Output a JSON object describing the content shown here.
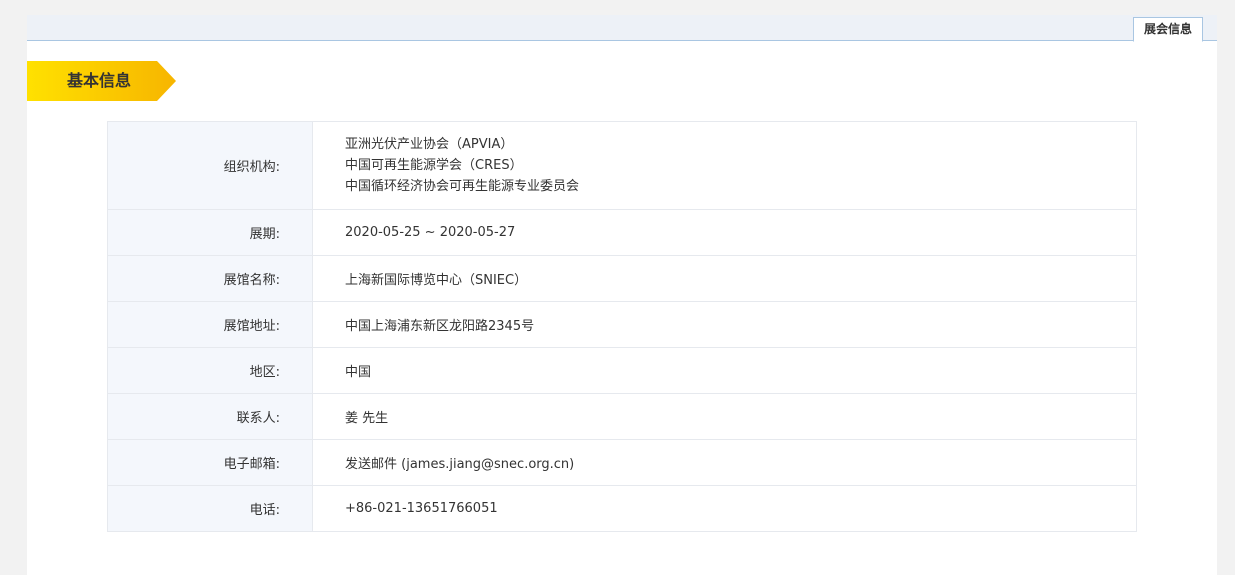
{
  "tab": {
    "label": "展会信息"
  },
  "section": {
    "title": "基本信息"
  },
  "rows": {
    "organizer": {
      "label": "组织机构:",
      "values": [
        "亚洲光伏产业协会（APVIA）",
        "中国可再生能源学会（CRES）",
        "中国循环经济协会可再生能源专业委员会"
      ]
    },
    "dates": {
      "label": "展期:",
      "value": "2020-05-25 ~ 2020-05-27"
    },
    "venue_name": {
      "label": "展馆名称:",
      "value": "上海新国际博览中心（SNIEC）"
    },
    "venue_address": {
      "label": "展馆地址:",
      "value": "中国上海浦东新区龙阳路2345号"
    },
    "region": {
      "label": "地区:",
      "value": "中国"
    },
    "contact": {
      "label": "联系人:",
      "value": "姜 先生"
    },
    "email": {
      "label": "电子邮箱:",
      "value": "发送邮件 (james.jiang@snec.org.cn)"
    },
    "phone": {
      "label": "电话:",
      "value": "+86-021-13651766051"
    }
  },
  "colors": {
    "banner_start": "#ffe100",
    "banner_end": "#f7b500",
    "label_bg": "#f4f7fc",
    "tabbar_bg": "#edf1f7",
    "tab_border": "#a9c6e2"
  }
}
